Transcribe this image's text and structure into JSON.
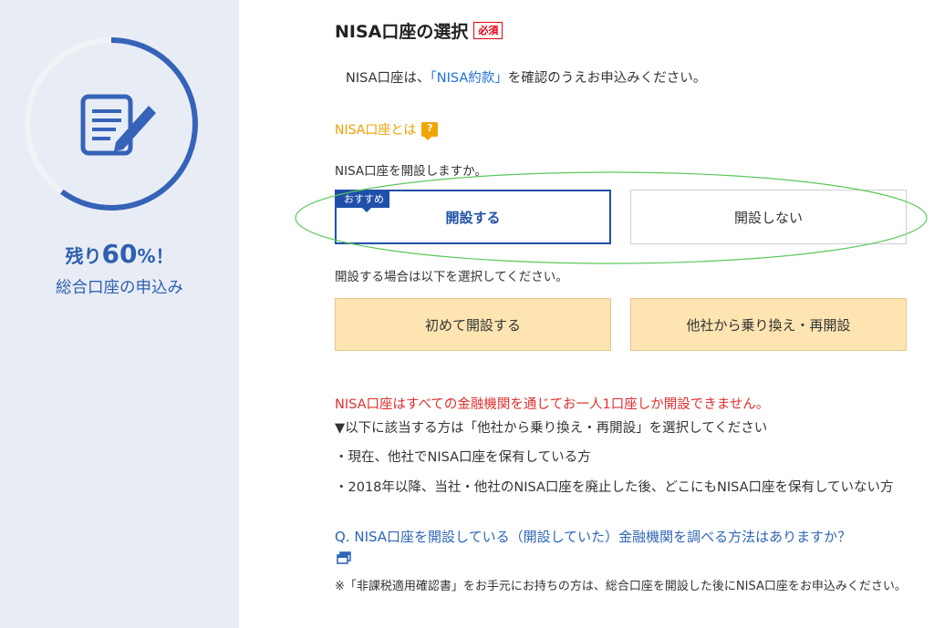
{
  "sidebar": {
    "remaining_prefix": "残り",
    "remaining_value": "60",
    "remaining_suffix": "%！",
    "progress_percent": 60,
    "app_title": "総合口座の申込み",
    "progress_color": "#3563b8",
    "icon": "document-edit-icon"
  },
  "section": {
    "title": "NISA口座の選択",
    "required_badge": "必須",
    "intro_prefix": "NISA口座は、",
    "intro_link": "「NISA約款」",
    "intro_suffix": "を確認のうえお申込みください。",
    "what_is_label": "NISA口座とは",
    "help_icon": "question-icon",
    "question": "NISA口座を開設しますか。",
    "recommend_tag": "おすすめ",
    "open_option": "開設する",
    "no_open_option": "開設しない",
    "select_note": "開設する場合は以下を選択してください。",
    "first_time_option": "初めて開設する",
    "transfer_option": "他社から乗り換え・再開設",
    "warning": "NISA口座はすべての金融機関を通じてお一人1口座しか開設できません。",
    "info_line_1": "▼以下に該当する方は「他社から乗り換え・再開設」を選択してください",
    "info_line_2": "・現在、他社でNISA口座を保有している方",
    "info_line_3": "・2018年以降、当社・他社のNISA口座を廃止した後、どこにもNISA口座を保有していない方",
    "faq_link": "Q. NISA口座を開設している（開設していた）金融機関を調べる方法はありますか？",
    "external_window_icon": "new-window-icon",
    "footnote": "※「非課税適用確認書」をお手元にお持ちの方は、総合口座を開設した後にNISA口座をお申込みください。"
  },
  "colors": {
    "primary": "#1f4fa8",
    "warning": "#e03030",
    "accent_orange": "#f0a000",
    "option_fill": "#fde4b1",
    "sidebar_bg": "#e8edf5"
  }
}
